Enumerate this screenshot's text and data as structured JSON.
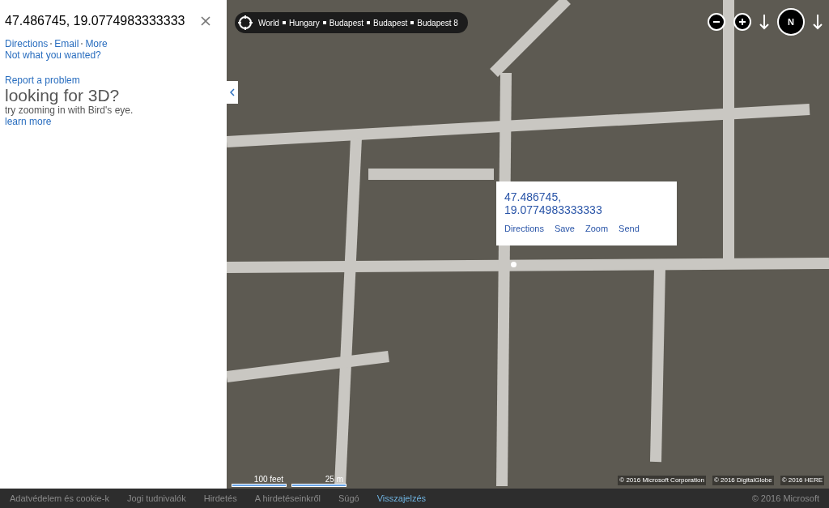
{
  "panel": {
    "title": "47.486745, 19.0774983333333",
    "links": [
      "Directions",
      "Email",
      "More"
    ],
    "not_wanted": "Not what you wanted?",
    "report": "Report a problem",
    "promo_heading": "looking for 3D?",
    "promo_text": "try zooming in with Bird's eye.",
    "promo_link": "learn more"
  },
  "map": {
    "breadcrumb": [
      "World",
      "Hungary",
      "Budapest",
      "Budapest",
      "Budapest 8"
    ],
    "popup": {
      "title": "47.486745, 19.0774983333333",
      "actions": [
        "Directions",
        "Save",
        "Zoom",
        "Send"
      ]
    },
    "compass": "N",
    "scale": [
      "100 feet",
      "25 m"
    ],
    "copyright": [
      "© 2016 Microsoft Corporation",
      "© 2016 DigitalGlobe",
      "© 2016 HERE"
    ]
  },
  "footer": {
    "links": [
      {
        "label": "Adatvédelem és cookie-k",
        "selected": false
      },
      {
        "label": "Jogi tudnivalók",
        "selected": false
      },
      {
        "label": "Hirdetés",
        "selected": false
      },
      {
        "label": "A hirdetéseinkről",
        "selected": false
      },
      {
        "label": "Súgó",
        "selected": false
      },
      {
        "label": "Visszajelzés",
        "selected": true
      }
    ],
    "copyright": "© 2016 Microsoft"
  }
}
